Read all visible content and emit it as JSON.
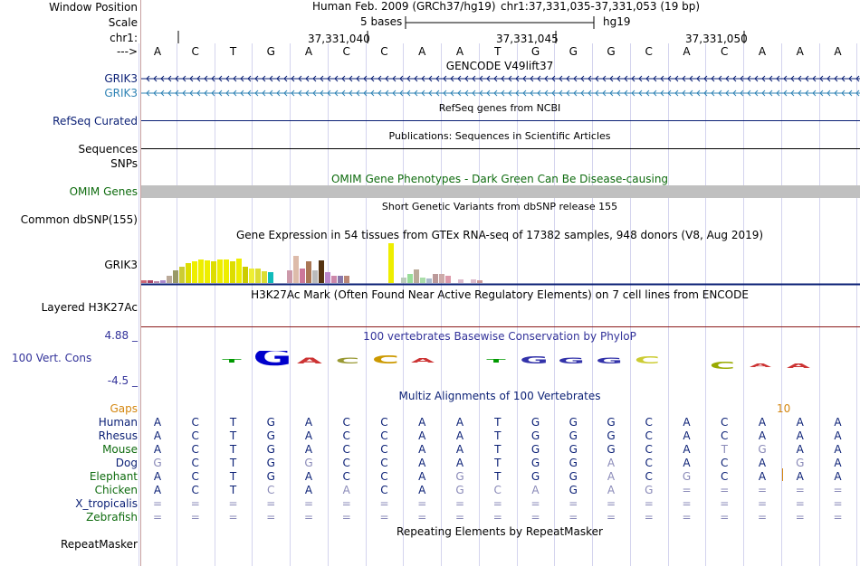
{
  "header": {
    "window_position_label": "Window Position",
    "scale_label": "Scale",
    "chrom_label": "chr1:",
    "arrow_label": "--->",
    "assembly_text": "Human Feb. 2009 (GRCh37/hg19)",
    "position_text": "chr1:37,331,035-37,331,053 (19 bp)",
    "scale_value": "5 bases",
    "scale_db": "hg19",
    "ruler_ticks": [
      "37,331,040",
      "37,331,045",
      "37,331,050"
    ]
  },
  "bases": [
    "A",
    "C",
    "T",
    "G",
    "A",
    "C",
    "C",
    "A",
    "A",
    "T",
    "G",
    "G",
    "G",
    "C",
    "A",
    "C",
    "A",
    "A",
    "A"
  ],
  "tracks": {
    "gencode": {
      "title": "GENCODE V49lift37",
      "genes": [
        "GRIK3",
        "GRIK3"
      ],
      "colors": [
        "#0a1f75",
        "#2f83b5"
      ]
    },
    "refseq": {
      "title": "RefSeq genes from NCBI",
      "label": "RefSeq Curated"
    },
    "pubs": {
      "title": "Publications: Sequences in Scientific Articles",
      "labels": [
        "Sequences",
        "SNPs"
      ]
    },
    "omim": {
      "title": "OMIM Gene Phenotypes - Dark Green Can Be Disease-causing",
      "label": "OMIM Genes"
    },
    "dbsnp": {
      "title": "Short Genetic Variants from dbSNP release 155",
      "label": "Common dbSNP(155)"
    },
    "gtex": {
      "title": "Gene Expression in 54 tissues from GTEx RNA-seq of 17382 samples, 948 donors (V8, Aug 2019)",
      "label": "GRIK3"
    },
    "h3k27ac": {
      "title": "H3K27Ac Mark (Often Found Near Active Regulatory Elements) on 7 cell lines from ENCODE",
      "label": "Layered H3K27Ac"
    },
    "phylop": {
      "title": "100 vertebrates Basewise Conservation by PhyloP",
      "label": "100 Vert. Cons",
      "max": "4.88 _",
      "min": "-4.5 _"
    },
    "multiz": {
      "title": "Multiz Alignments of 100 Vertebrates",
      "gaps_label": "Gaps",
      "gap_value": "10",
      "species": [
        {
          "name": "Human",
          "seq": [
            "A",
            "C",
            "T",
            "G",
            "A",
            "C",
            "C",
            "A",
            "A",
            "T",
            "G",
            "G",
            "G",
            "C",
            "A",
            "C",
            "A",
            "A",
            "A"
          ]
        },
        {
          "name": "Rhesus",
          "seq": [
            "A",
            "C",
            "T",
            "G",
            "A",
            "C",
            "C",
            "A",
            "A",
            "T",
            "G",
            "G",
            "G",
            "C",
            "A",
            "C",
            "A",
            "A",
            "A"
          ]
        },
        {
          "name": "Mouse",
          "seq": [
            "A",
            "C",
            "T",
            "G",
            "A",
            "C",
            "C",
            "A",
            "A",
            "T",
            "G",
            "G",
            "G",
            "C",
            "A",
            "T",
            "G",
            "A",
            "A"
          ]
        },
        {
          "name": "Dog",
          "seq": [
            "G",
            "C",
            "T",
            "G",
            "G",
            "C",
            "C",
            "A",
            "A",
            "T",
            "G",
            "G",
            "A",
            "C",
            "A",
            "C",
            "A",
            "G",
            "A"
          ]
        },
        {
          "name": "Elephant",
          "seq": [
            "A",
            "C",
            "T",
            "G",
            "A",
            "C",
            "C",
            "A",
            "G",
            "T",
            "G",
            "G",
            "A",
            "C",
            "G",
            "C",
            "A",
            "A",
            "A"
          ]
        },
        {
          "name": "Chicken",
          "seq": [
            "A",
            "C",
            "T",
            "C",
            "A",
            "A",
            "C",
            "A",
            "G",
            "C",
            "A",
            "G",
            "A",
            "G",
            "=",
            "=",
            "=",
            "=",
            "="
          ]
        },
        {
          "name": "X_tropicalis",
          "seq": [
            "=",
            "=",
            "=",
            "=",
            "=",
            "=",
            "=",
            "=",
            "=",
            "=",
            "=",
            "=",
            "=",
            "=",
            "=",
            "=",
            "=",
            "=",
            "="
          ]
        },
        {
          "name": "Zebrafish",
          "seq": [
            "=",
            "=",
            "=",
            "=",
            "=",
            "=",
            "=",
            "=",
            "=",
            "=",
            "=",
            "=",
            "=",
            "=",
            "=",
            "=",
            "=",
            "=",
            "="
          ]
        }
      ]
    },
    "repeatmasker": {
      "title": "Repeating Elements by RepeatMasker",
      "label": "RepeatMasker"
    }
  },
  "colors": {
    "navy": "#0a1f75",
    "teal": "#2f83b5",
    "label_blue": "#33339a",
    "omim_green": "#0e6b0e",
    "gap_orange": "#d4860f",
    "grid": "#c8c8e6",
    "omim_bar": "#c0c0c0"
  }
}
